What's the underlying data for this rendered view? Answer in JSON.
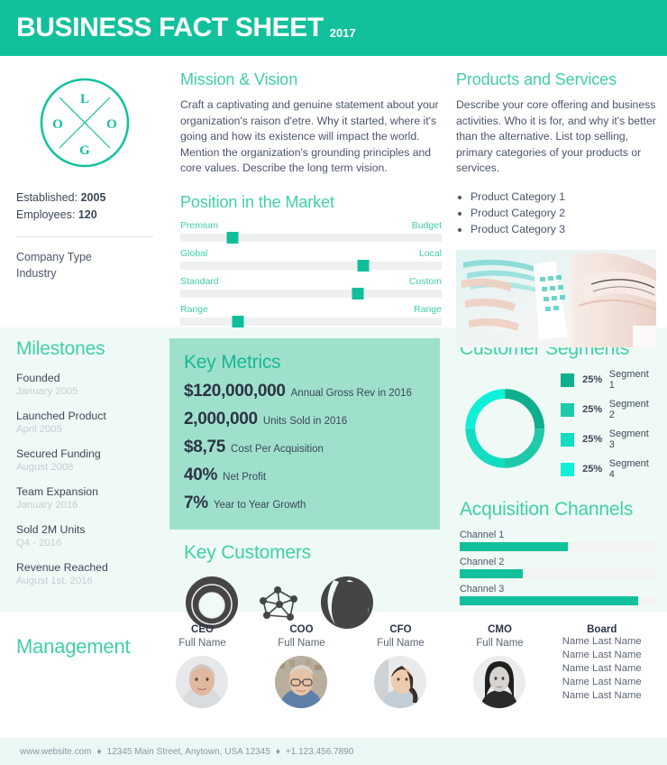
{
  "header": {
    "title": "BUSINESS FACT SHEET",
    "year": "2017"
  },
  "logo": {
    "letters": [
      "L",
      "O",
      "O",
      "G"
    ],
    "color": "#12c19c"
  },
  "company": {
    "established_label": "Established:",
    "established_value": "2005",
    "employees_label": "Employees:",
    "employees_value": "120",
    "type": "Company Type",
    "industry": "Industry"
  },
  "mission": {
    "heading": "Mission & Vision",
    "body": "Craft a captivating and genuine statement about your organization's raison d'etre. Why it started, where it's going and how its existence will impact the world. Mention the organization's grounding principles and core values. Describe the long term vision."
  },
  "position": {
    "heading": "Position in the Market",
    "sliders": [
      {
        "left": "Premium",
        "right": "Budget",
        "value": 20
      },
      {
        "left": "Global",
        "right": "Local",
        "value": 70
      },
      {
        "left": "Standard",
        "right": "Custom",
        "value": 68
      },
      {
        "left": "Range",
        "right": "Range",
        "value": 22
      }
    ]
  },
  "products": {
    "heading": "Products and Services",
    "body": "Describe your core offering and business activities. Who it is for, and why it's better than the alternative. List top selling, primary categories of your products or services.",
    "categories": [
      "Product Category 1",
      "Product Category 2",
      "Product Category 3"
    ],
    "photo_alt": "architecture-interior-photo"
  },
  "milestones": {
    "heading": "Milestones",
    "items": [
      {
        "title": "Founded",
        "date": "January 2005"
      },
      {
        "title": "Launched Product",
        "date": "April 2005"
      },
      {
        "title": "Secured Funding",
        "date": "August 2008"
      },
      {
        "title": "Team Expansion",
        "date": "January 2016"
      },
      {
        "title": "Sold 2M Units",
        "date": "Q4 - 2016"
      },
      {
        "title": "Revenue Reached",
        "date": "August 1st, 2016"
      }
    ]
  },
  "key_metrics": {
    "heading": "Key Metrics",
    "items": [
      {
        "value": "$120,000,000",
        "label": "Annual Gross Rev in 2016"
      },
      {
        "value": "2,000,000",
        "label": "Units Sold in 2016"
      },
      {
        "value": "$8,75",
        "label": "Cost Per Acquisition"
      },
      {
        "value": "40%",
        "label": "Net Profit"
      },
      {
        "value": "7%",
        "label": "Year to Year Growth"
      }
    ]
  },
  "key_customers": {
    "heading": "Key Customers",
    "logos": [
      "ring-logo-icon",
      "network-logo-icon",
      "sphere-logo-icon"
    ]
  },
  "chart_data": [
    {
      "type": "pie",
      "title": "Customer Segments",
      "labels": [
        "Segment 1",
        "Segment 2",
        "Segment 3",
        "Segment 4"
      ],
      "values": [
        25,
        25,
        25,
        25
      ],
      "value_labels": [
        "25%",
        "25%",
        "25%",
        "25%"
      ],
      "colors": [
        "#0fae8d",
        "#1fc9a9",
        "#12ddc0",
        "#0ff0d8"
      ],
      "legend": "right",
      "donut": true
    },
    {
      "type": "bar",
      "title": "Acquisition Channels",
      "orientation": "horizontal",
      "categories": [
        "Channel 1",
        "Channel 2",
        "Channel 3"
      ],
      "values": [
        55,
        32,
        91
      ],
      "xlim": [
        0,
        100
      ],
      "color": "#12c19c",
      "track_color": "#f3f3f1",
      "grid": false
    }
  ],
  "management": {
    "heading": "Management",
    "people": [
      {
        "role": "CEO",
        "name": "Full Name",
        "photo": "portrait-ceo"
      },
      {
        "role": "COO",
        "name": "Full Name",
        "photo": "portrait-coo"
      },
      {
        "role": "CFO",
        "name": "Full Name",
        "photo": "portrait-cfo"
      },
      {
        "role": "CMO",
        "name": "Full Name",
        "photo": "portrait-cmo"
      }
    ],
    "board_title": "Board",
    "board_members": [
      "Name Last Name",
      "Name Last Name",
      "Name Last Name",
      "Name Last Name",
      "Name Last Name"
    ]
  },
  "footer": {
    "website": "www.website.com",
    "address": "12345 Main Street, Anytown, USA 12345",
    "phone": "+1.123.456.7890",
    "separator": "♦"
  }
}
